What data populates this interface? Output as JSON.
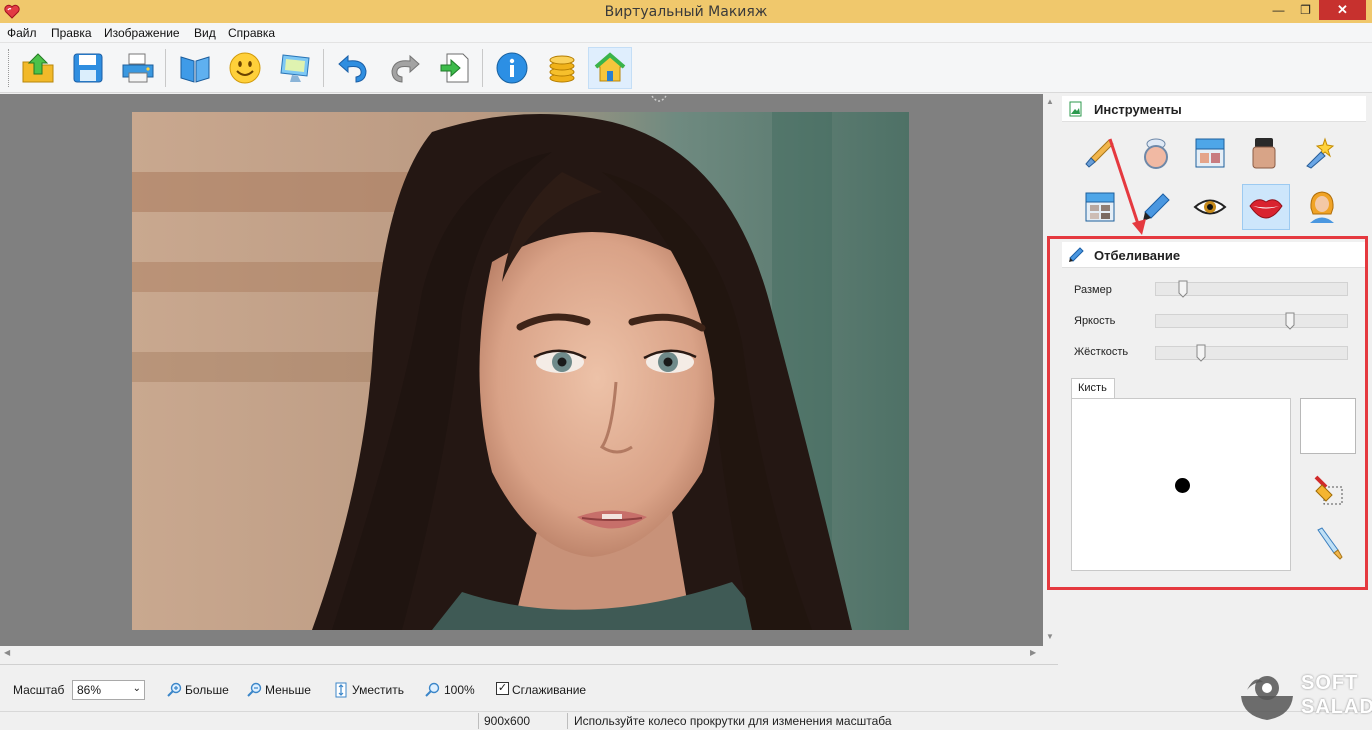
{
  "window": {
    "title": "Виртуальный Макияж",
    "controls": {
      "minimize": "—",
      "maximize": "❐",
      "close": "✕"
    }
  },
  "menu": [
    "Файл",
    "Правка",
    "Изображение",
    "Вид",
    "Справка"
  ],
  "toolbar": {
    "buttons": [
      {
        "name": "open-icon"
      },
      {
        "name": "save-icon"
      },
      {
        "name": "print-icon"
      },
      {
        "name": "book-icon"
      },
      {
        "name": "smiley-icon"
      },
      {
        "name": "monitor-icon"
      },
      {
        "name": "undo-icon"
      },
      {
        "name": "redo-icon"
      },
      {
        "name": "export-icon"
      },
      {
        "name": "info-icon"
      },
      {
        "name": "coins-icon"
      },
      {
        "name": "home-icon"
      }
    ],
    "active_button": "home-icon"
  },
  "image": {
    "size": "900x600"
  },
  "zoom": {
    "label": "Масштаб",
    "value": "86%",
    "more": "Больше",
    "less": "Меньше",
    "fit": "Уместить",
    "actual": "100%",
    "smoothing_label": "Сглаживание",
    "smoothing_checked": "✓"
  },
  "status": {
    "size": "900x600",
    "hint": "Используйте колесо прокрутки для изменения масштаба"
  },
  "tools_panel": {
    "title": "Инструменты",
    "tools": [
      {
        "name": "brush-tool-icon"
      },
      {
        "name": "compact-powder-icon"
      },
      {
        "name": "palette-box-icon"
      },
      {
        "name": "foundation-jar-icon"
      },
      {
        "name": "sparkle-tool-icon"
      },
      {
        "name": "eyeshadow-palette-icon"
      },
      {
        "name": "eyeliner-pencil-icon"
      },
      {
        "name": "eye-icon"
      },
      {
        "name": "lips-icon"
      },
      {
        "name": "hair-person-icon"
      }
    ],
    "selected_tool": "lips-icon"
  },
  "whitening_panel": {
    "title": "Отбеливание",
    "sliders": [
      {
        "label": "Размер",
        "value": 0.12
      },
      {
        "label": "Яркость",
        "value": 0.71
      },
      {
        "label": "Жёсткость",
        "value": 0.22
      }
    ],
    "brush_tab": "Кисть",
    "swatch_color": "#ffffff"
  },
  "watermark": {
    "line1": "SOFT",
    "line2": "SALAD"
  },
  "colors": {
    "titlebar": "#f0c86c",
    "accent_red": "#e5393f",
    "selected_tool_bg": "#cde6fb"
  }
}
